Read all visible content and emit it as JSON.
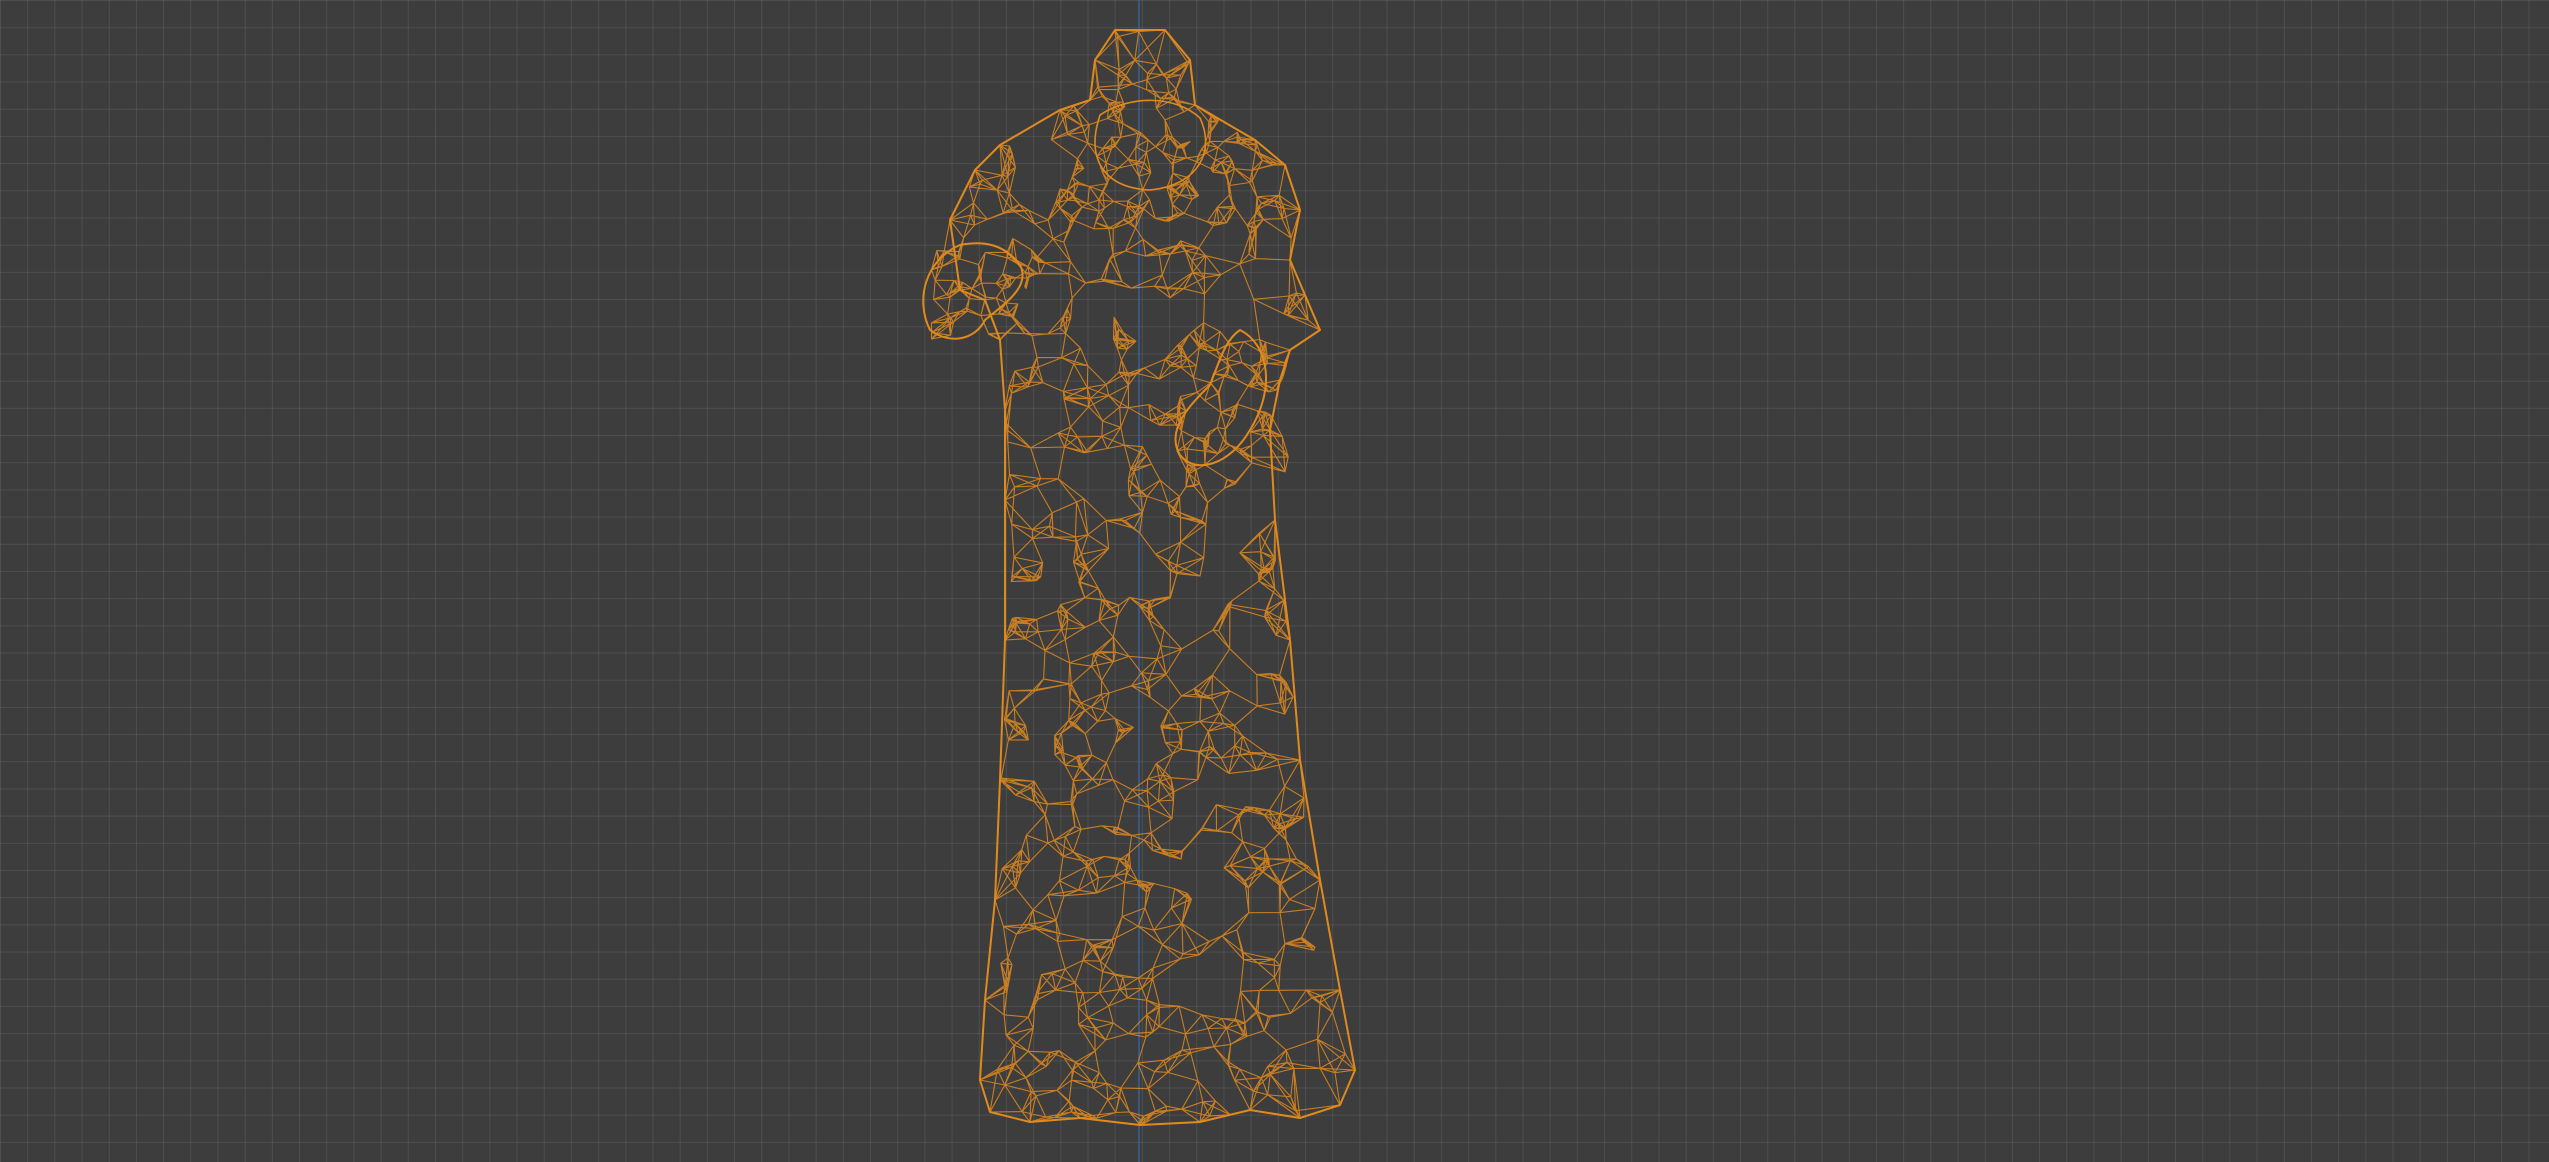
{
  "viewport": {
    "background_color": "#3d3d3d",
    "grid_color": "#4a4a4a",
    "axis_color": "#3a5f8f"
  },
  "mesh": {
    "wire_color": "#e08a1e",
    "display_mode": "wireframe",
    "selected": true
  }
}
